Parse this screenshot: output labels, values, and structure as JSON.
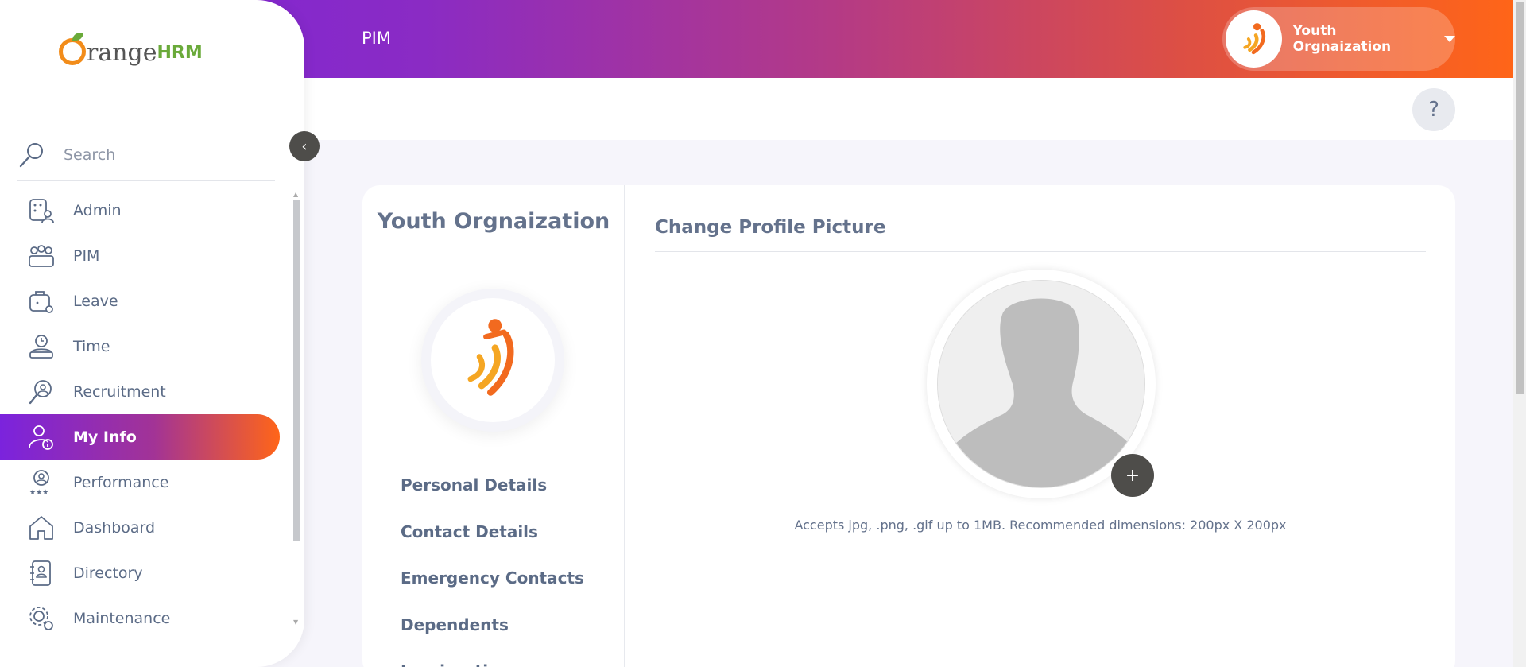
{
  "header": {
    "page_title": "PIM",
    "user_name": "Youth Orgnaization"
  },
  "help": {
    "label": "?"
  },
  "sidebar": {
    "logo": {
      "text_main": "range",
      "text_accent": "HRM"
    },
    "search": {
      "label": "Search"
    },
    "collapse_label": "‹",
    "items": [
      {
        "label": "Admin",
        "icon": "admin-icon"
      },
      {
        "label": "PIM",
        "icon": "pim-icon"
      },
      {
        "label": "Leave",
        "icon": "leave-icon"
      },
      {
        "label": "Time",
        "icon": "time-icon"
      },
      {
        "label": "Recruitment",
        "icon": "recruitment-icon"
      },
      {
        "label": "My Info",
        "icon": "my-info-icon",
        "active": true
      },
      {
        "label": "Performance",
        "icon": "performance-icon"
      },
      {
        "label": "Dashboard",
        "icon": "dashboard-icon"
      },
      {
        "label": "Directory",
        "icon": "directory-icon"
      },
      {
        "label": "Maintenance",
        "icon": "maintenance-icon"
      }
    ]
  },
  "profile": {
    "employee_name": "Youth Orgnaization",
    "tabs": [
      "Personal Details",
      "Contact Details",
      "Emergency Contacts",
      "Dependents",
      "Immigration"
    ]
  },
  "picture_section": {
    "title": "Change Profile Picture",
    "add_label": "+",
    "hint": "Accepts jpg, .png, .gif up to 1MB. Recommended dimensions: 200px X 200px"
  },
  "colors": {
    "gradient_start": "#7b23dd",
    "gradient_end": "#ff6518",
    "text": "#64728c",
    "accent_green": "#6aaa3a",
    "accent_orange": "#f28c1a"
  }
}
